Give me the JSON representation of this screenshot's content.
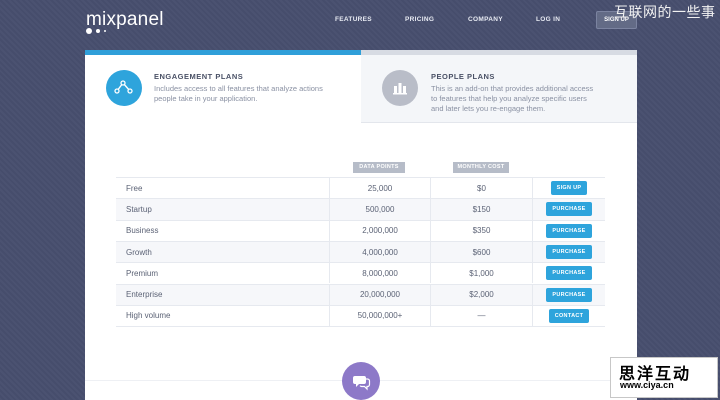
{
  "brand": {
    "logo": "mixpanel"
  },
  "nav": {
    "items": [
      "FEATURES",
      "PRICING",
      "COMPANY",
      "LOG IN"
    ],
    "signup": "SIGN UP"
  },
  "tabs": [
    {
      "title": "ENGAGEMENT PLANS",
      "desc": "Includes access to all features that analyze actions people take in your application.",
      "icon": "line-chart-icon",
      "active": true
    },
    {
      "title": "PEOPLE PLANS",
      "desc": "This is an add-on that provides additional access to features that help you analyze specific users and later lets you re-engage them.",
      "icon": "people-icon",
      "active": false
    }
  ],
  "pricing": {
    "columns": {
      "data_points": "DATA POINTS",
      "monthly_cost": "MONTHLY COST"
    },
    "rows": [
      {
        "plan": "Free",
        "points": "25,000",
        "cost": "$0",
        "action": "SIGN UP"
      },
      {
        "plan": "Startup",
        "points": "500,000",
        "cost": "$150",
        "action": "PURCHASE"
      },
      {
        "plan": "Business",
        "points": "2,000,000",
        "cost": "$350",
        "action": "PURCHASE"
      },
      {
        "plan": "Growth",
        "points": "4,000,000",
        "cost": "$600",
        "action": "PURCHASE"
      },
      {
        "plan": "Premium",
        "points": "8,000,000",
        "cost": "$1,000",
        "action": "PURCHASE"
      },
      {
        "plan": "Enterprise",
        "points": "20,000,000",
        "cost": "$2,000",
        "action": "PURCHASE"
      },
      {
        "plan": "High volume",
        "points": "50,000,000+",
        "cost": "—",
        "action": "CONTACT"
      }
    ]
  },
  "chat": {
    "icon": "chat-bubble-icon"
  },
  "watermark": {
    "top": "互联网的一些事",
    "cn": "思洋互动",
    "url": "www.ciya.cn"
  },
  "colors": {
    "background": "#474f6e",
    "accent": "#2f9fd9",
    "button": "#2ea4dc",
    "chat": "#8d79c8",
    "header_badge": "#b6bcc8"
  }
}
